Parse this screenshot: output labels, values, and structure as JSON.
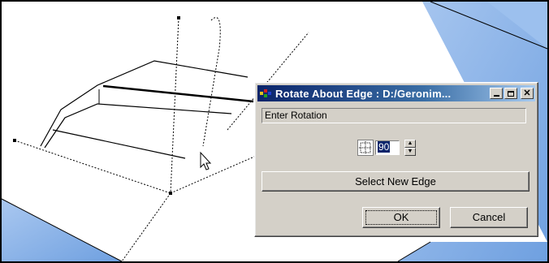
{
  "dialog": {
    "title": "Rotate About Edge : D:/Geronim...",
    "minimize_icon": "minimize-icon",
    "maximize_icon": "maximize-icon",
    "close_icon": "close-icon",
    "prompt": "Enter Rotation",
    "rotation_value": "90",
    "pivot_icon": "pivot-icon",
    "select_edge_label": "Select New Edge",
    "ok_label": "OK",
    "cancel_label": "Cancel"
  },
  "viewport": {
    "background_color": "#ffffff",
    "sky_color": "#8fb8e8",
    "cursor_icon": "arrow-cursor-icon"
  }
}
